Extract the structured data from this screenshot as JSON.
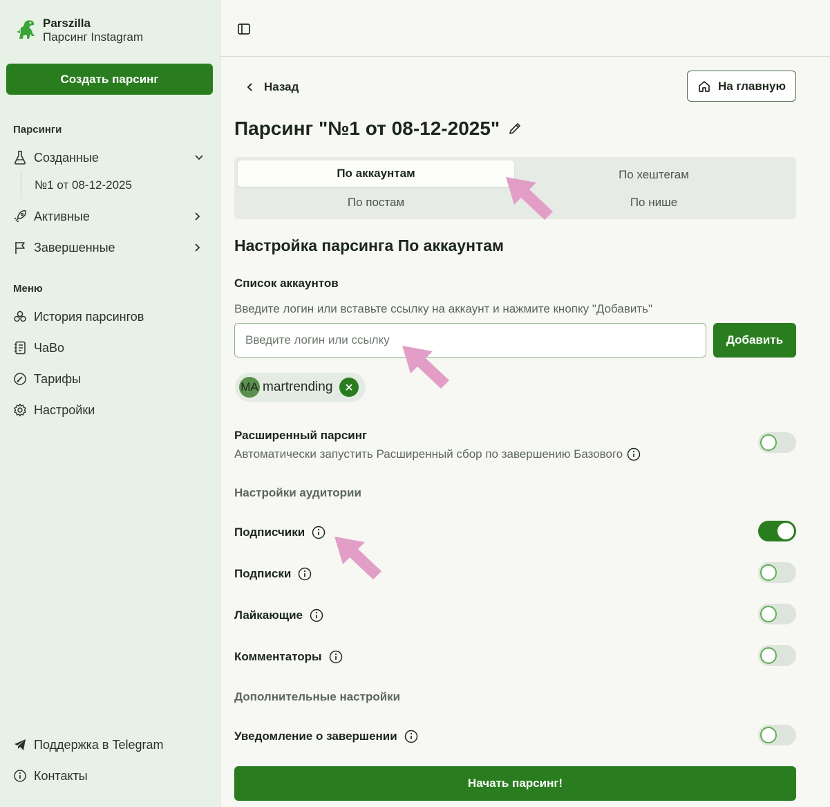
{
  "brand": {
    "name": "Parszilla",
    "subtitle": "Парсинг Instagram"
  },
  "sidebar": {
    "create_button": "Создать парсинг",
    "parsings_label": "Парсинги",
    "created": {
      "label": "Созданные",
      "children": [
        "№1 от 08-12-2025"
      ]
    },
    "active_label": "Активные",
    "finished_label": "Завершенные",
    "menu_label": "Меню",
    "menu_items": [
      "История парсингов",
      "ЧаВо",
      "Тарифы",
      "Настройки"
    ],
    "footer_items": [
      "Поддержка в Telegram",
      "Контакты"
    ]
  },
  "header": {
    "back_label": "Назад",
    "home_label": "На главную"
  },
  "page": {
    "title": "Парсинг \"№1 от 08-12-2025\""
  },
  "tabs": [
    {
      "label": "По аккаунтам",
      "active": true
    },
    {
      "label": "По хештегам",
      "active": false
    },
    {
      "label": "По постам",
      "active": false
    },
    {
      "label": "По нише",
      "active": false
    }
  ],
  "settings": {
    "heading": "Настройка парсинга По аккаунтам",
    "accounts_label": "Список аккаунтов",
    "accounts_hint": "Введите логин или вставьте ссылку на аккаунт и нажмите кнопку \"Добавить\"",
    "input_placeholder": "Введите логин или ссылку",
    "add_button": "Добавить",
    "chip": {
      "initials": "MA",
      "username": "martrending"
    },
    "extended": {
      "title": "Расширенный парсинг",
      "description": "Автоматически запустить Расширенный сбор по завершению Базового",
      "enabled": false
    },
    "audience_label": "Настройки аудитории",
    "audience": [
      {
        "label": "Подписчики",
        "enabled": true
      },
      {
        "label": "Подписки",
        "enabled": false
      },
      {
        "label": "Лайкающие",
        "enabled": false
      },
      {
        "label": "Комментаторы",
        "enabled": false
      }
    ],
    "extra_label": "Дополнительные настройки",
    "notify": {
      "label": "Уведомление о завершении",
      "enabled": false
    },
    "start_button": "Начать парсинг!"
  },
  "colors": {
    "primary": "#2a7d1f",
    "sidebar_bg": "#e8f1e6",
    "annotation_arrow": "#e29ec6"
  }
}
